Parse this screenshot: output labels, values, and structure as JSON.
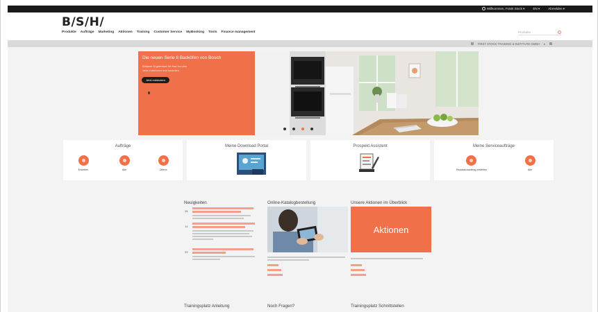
{
  "topbar": {
    "account": "Willkommen, Frank Stock",
    "language": "EN",
    "logout": "Abmelden"
  },
  "header": {
    "logo": "B/S/H/",
    "nav": [
      "Produkte",
      "Aufträge",
      "Marketing",
      "Aktionen",
      "Training",
      "Customer Service",
      "MyBooking",
      "Tools",
      "Finance management"
    ],
    "search_placeholder": "Produkte"
  },
  "subbar": {
    "text": "FIRST STOCK TRAINING & INSTITUTE GMBH"
  },
  "hero": {
    "title": "Die neuen Serie 8 Backöfen von Bosch",
    "sub1": "Brillante Ergebnisse für Ihre Kunden",
    "sub2": "Jetzt entdecken und bestellen",
    "button": "Jetzt entdecken",
    "slide_count": 4,
    "active_slide": 2
  },
  "tiles": [
    {
      "title": "Aufträge",
      "actions": [
        "Erstellen",
        "Alle",
        "Offene"
      ]
    },
    {
      "title": "Meine Download Portal"
    },
    {
      "title": "Prospekt Assistent"
    },
    {
      "title": "Meine Serviceaufträge",
      "actions": [
        "Reparaturauftrag erstellen",
        "Alle"
      ]
    }
  ],
  "columns": {
    "news": {
      "title": "Neuigkeiten",
      "dates": [
        "25",
        "14",
        "09"
      ]
    },
    "catalog": {
      "title": "Online-Katalogbestellung"
    },
    "promos": {
      "title": "Unsere Aktionen im Überblick",
      "box_label": "Aktionen"
    }
  },
  "bottom_titles": [
    "Trainingsplatz Anleitung",
    "Noch Fragen?",
    "Trainingsplatz Schnittstellen"
  ],
  "colors": {
    "accent": "#f0704a",
    "topbar": "#1a1a1a",
    "background": "#f3f3f3"
  }
}
